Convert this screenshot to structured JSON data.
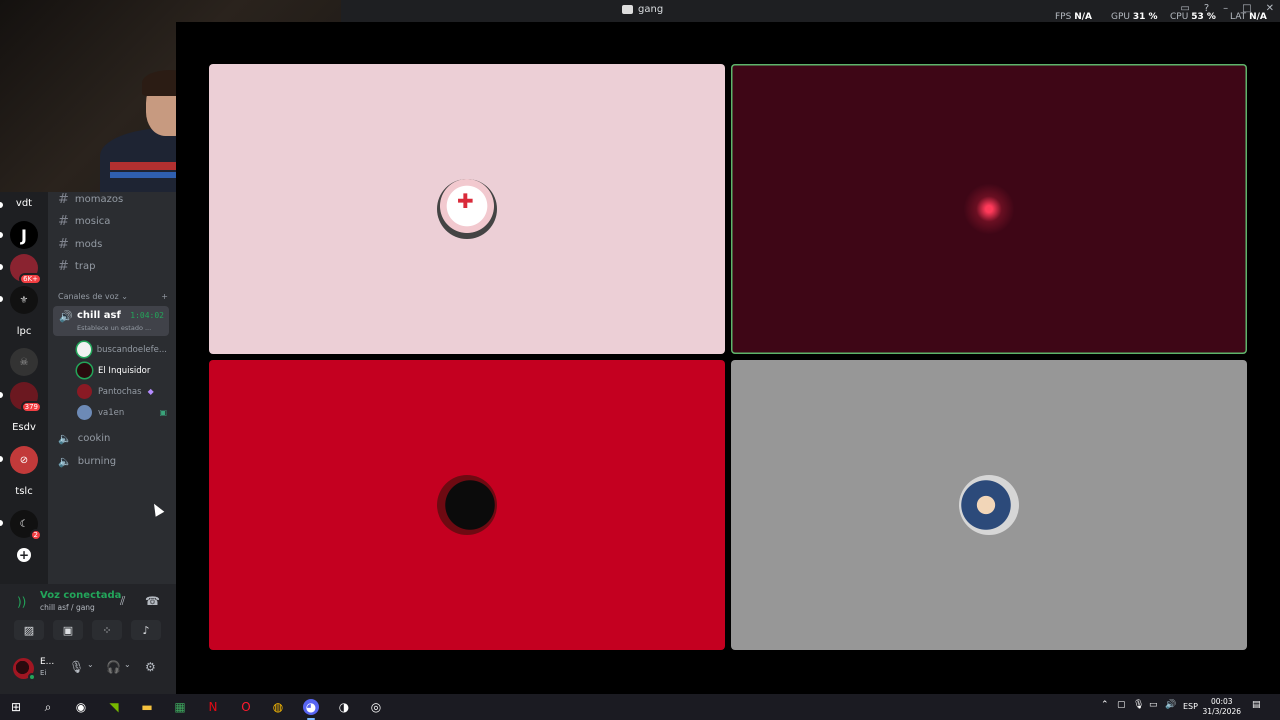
{
  "window": {
    "title": "gang",
    "perf": {
      "fps_label": "FPS",
      "fps_value": "N/A",
      "gpu_label": "GPU",
      "gpu_value": "31 %",
      "cpu_label": "CPU",
      "cpu_value": "53 %",
      "lat_label": "LAT",
      "lat_value": "N/A"
    }
  },
  "servers": [
    {
      "label": "vdt"
    },
    {
      "label": "J"
    },
    {
      "badge": "6K+"
    },
    {
      "label": ""
    },
    {
      "label": "lpc"
    },
    {
      "label": ""
    },
    {
      "badge": "379"
    },
    {
      "label": "Esdv"
    },
    {
      "label": ""
    },
    {
      "label": "tslc"
    },
    {
      "badge": "2"
    },
    {
      "label": "+"
    }
  ],
  "text_channels": [
    "momazos",
    "mosica",
    "mods",
    "trap"
  ],
  "voice_category": {
    "label": "Canales de voz",
    "add": "+"
  },
  "active_voice": {
    "name": "chill asf",
    "timer": "1:04:02",
    "status": "Establece un estado ..."
  },
  "members": [
    {
      "name": "buscandoelefe...",
      "color": "#f1f1f1"
    },
    {
      "name": "El Inquisidor",
      "color": "#2a0a0e"
    },
    {
      "name": "Pantochas",
      "color": "#8a1a24"
    },
    {
      "name": "va1en",
      "color": "#6d8ab6"
    }
  ],
  "voice_channels": [
    "cookin",
    "burning"
  ],
  "voice_panel": {
    "status": "Voz conectada",
    "channel": "chill asf / gang"
  },
  "user": {
    "name": "E...",
    "tag": "Ei"
  },
  "tiles": [
    {
      "bg": "#eccfd6",
      "speaking": false
    },
    {
      "bg": "#3e0616",
      "speaking": true
    },
    {
      "bg": "#c40020",
      "speaking": false
    },
    {
      "bg": "#979797",
      "speaking": false
    }
  ],
  "taskbar": {
    "lang": "ESP",
    "time": "00:03",
    "date": "31/3/2026"
  }
}
